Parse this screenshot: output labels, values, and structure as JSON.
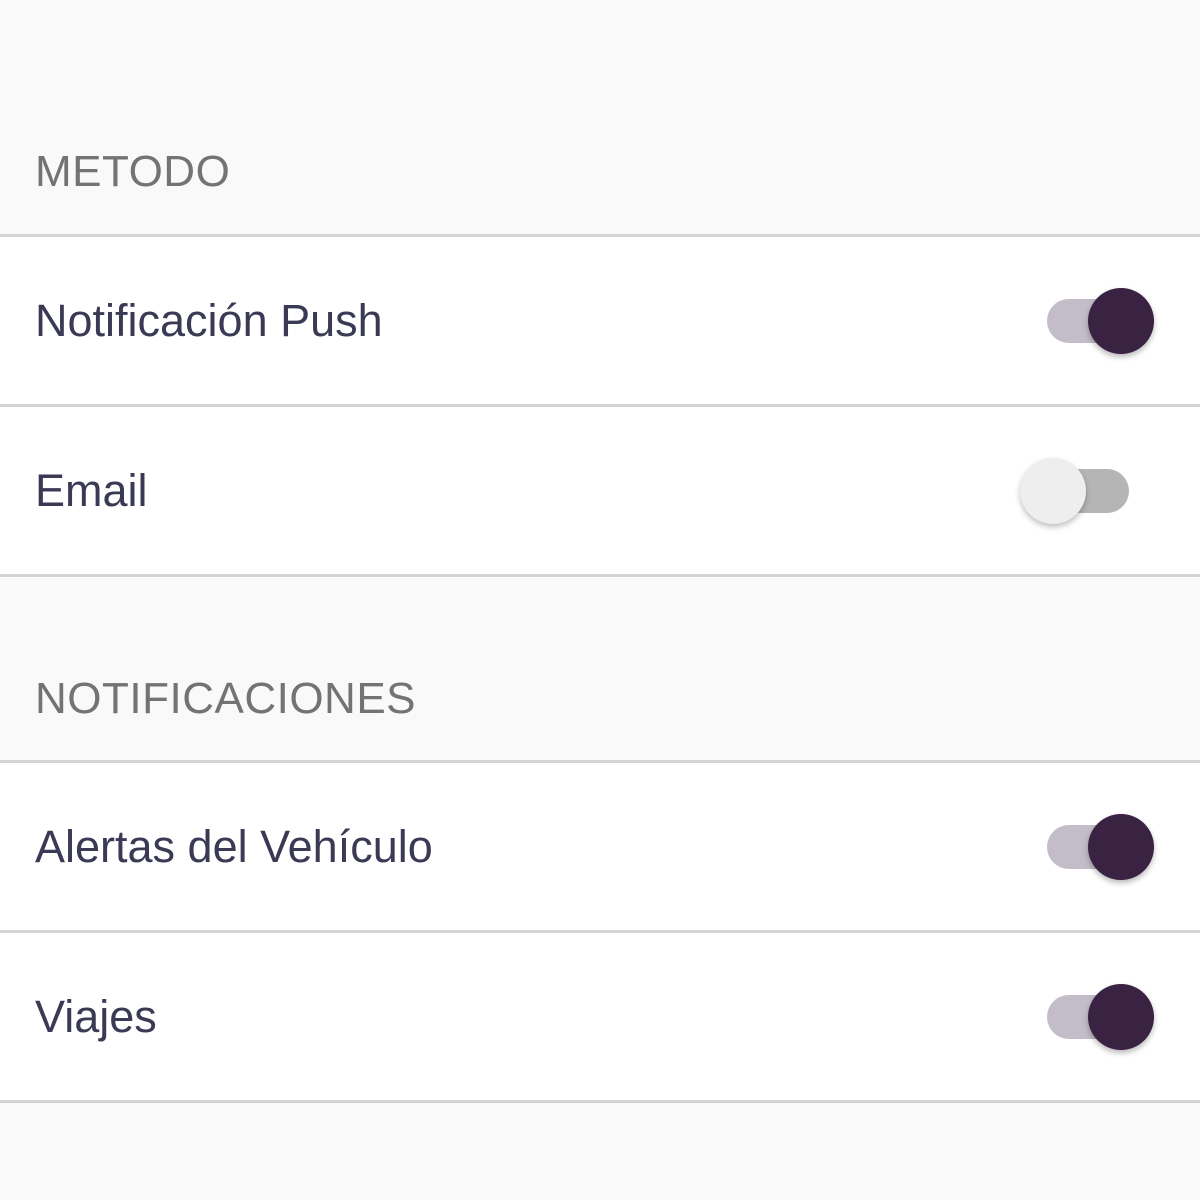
{
  "colors": {
    "background": "#f9f9f9",
    "row_background": "#ffffff",
    "divider": "#d4d4d4",
    "header_text": "#737373",
    "row_text": "#3a3a55",
    "switch_on_thumb": "#3a2242",
    "switch_on_track": "#c2bdc8",
    "switch_off_thumb": "#eeeeee",
    "switch_off_track": "#b5b5b5"
  },
  "sections": [
    {
      "header": "METODO",
      "rows": [
        {
          "label": "Notificación Push",
          "enabled": true
        },
        {
          "label": "Email",
          "enabled": false
        }
      ]
    },
    {
      "header": "NOTIFICACIONES",
      "rows": [
        {
          "label": "Alertas del Vehículo",
          "enabled": true
        },
        {
          "label": "Viajes",
          "enabled": true
        }
      ]
    }
  ]
}
